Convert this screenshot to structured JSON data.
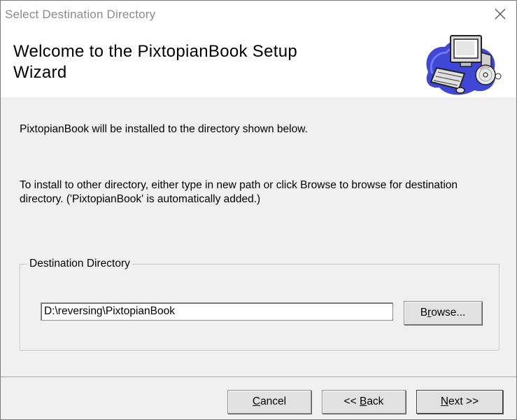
{
  "window": {
    "title": "Select Destination Directory"
  },
  "header": {
    "title_line1": "Welcome to the PixtopianBook Setup",
    "title_line2": "Wizard",
    "art_icon": "computer-with-cd-icon"
  },
  "body": {
    "message1": "PixtopianBook will be installed to the directory shown below.",
    "message2": "To install to other directory, either type in new path or click Browse to browse for destination directory. ('PixtopianBook' is automatically added.)"
  },
  "destination": {
    "group_label": "Destination Directory",
    "path_value": "D:\\reversing\\PixtopianBook",
    "browse_label_prefix": "B",
    "browse_label_accel": "r",
    "browse_label_rest": "owse..."
  },
  "footer": {
    "cancel_accel": "C",
    "cancel_rest": "ancel",
    "back_prefix": "<< ",
    "back_accel": "B",
    "back_rest": "ack",
    "next_accel": "N",
    "next_rest": "ext >>"
  },
  "colors": {
    "window_bg": "#f0f0f0",
    "header_bg": "#ffffff",
    "title_text": "#8a8a8a"
  }
}
